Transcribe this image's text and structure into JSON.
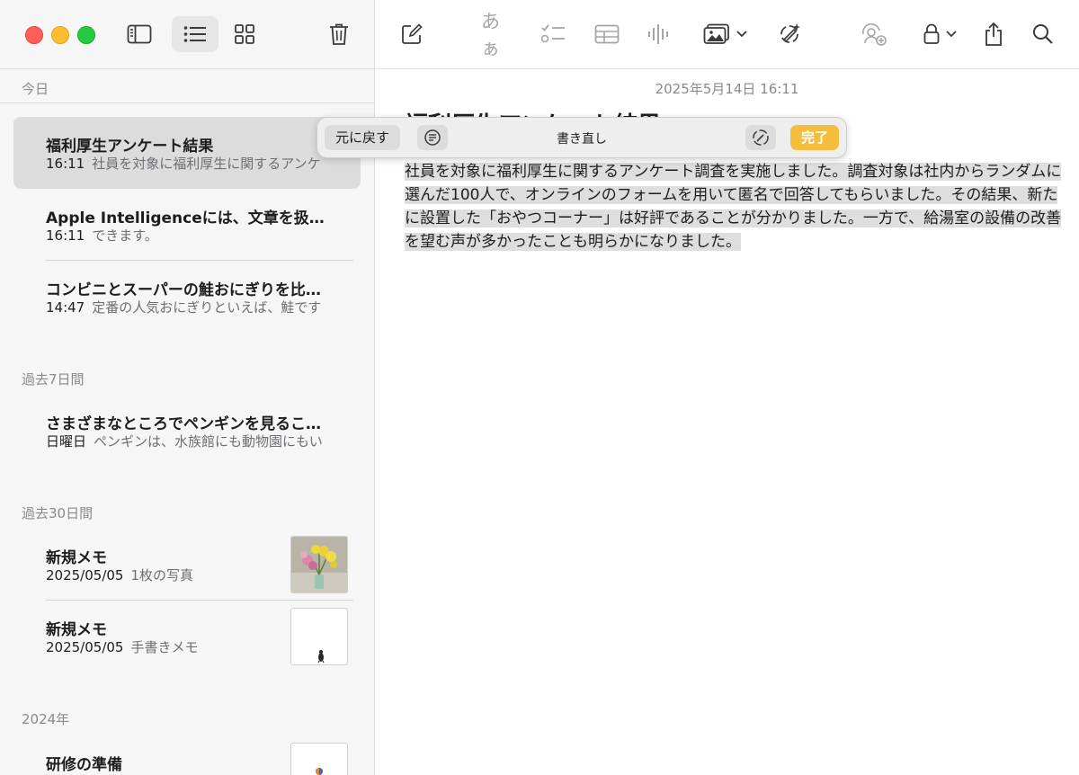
{
  "sidebar": {
    "sections": [
      {
        "label": "今日"
      },
      {
        "label": "過去7日間"
      },
      {
        "label": "過去30日間"
      },
      {
        "label": "2024年"
      }
    ],
    "notes": [
      {
        "title": "福利厚生アンケート結果",
        "time": "16:11",
        "preview": "社員を対象に福利厚生に関するアンケ"
      },
      {
        "title": "Apple Intelligenceには、文章を扱…",
        "time": "16:11",
        "preview": "できます。"
      },
      {
        "title": "コンビニとスーパーの鮭おにぎりを比…",
        "time": "14:47",
        "preview": "定番の人気おにぎりといえば、鮭です"
      },
      {
        "title": "さまざまなところでペンギンを見るこ…",
        "time": "日曜日",
        "preview": "ペンギンは、水族館にも動物園にもい"
      },
      {
        "title": "新規メモ",
        "time": "2025/05/05",
        "preview": "1枚の写真"
      },
      {
        "title": "新規メモ",
        "time": "2025/05/05",
        "preview": "手書きメモ"
      },
      {
        "title": "研修の準備",
        "time": "",
        "preview": ""
      }
    ]
  },
  "toolbar": {
    "format_label": "あぁ"
  },
  "editor": {
    "date": "2025年5月14日 16:11",
    "heading": "福利厚生アンケート結果",
    "body": "社員を対象に福利厚生に関するアンケート調査を実施しました。調査対象は社内からランダムに選んだ100人で、オンラインのフォームを用いて匿名で回答してもらいました。その結果、新たに設置した「おやつコーナー」は好評であることが分かりました。一方で、給湯室の設備の改善を望む声が多かったことも明らかになりました。"
  },
  "writing_tools": {
    "undo_label": "元に戻す",
    "title": "書き直し",
    "done_label": "完了"
  },
  "colors": {
    "accent": "#f4be3c",
    "selection": "#dcdcdc"
  }
}
